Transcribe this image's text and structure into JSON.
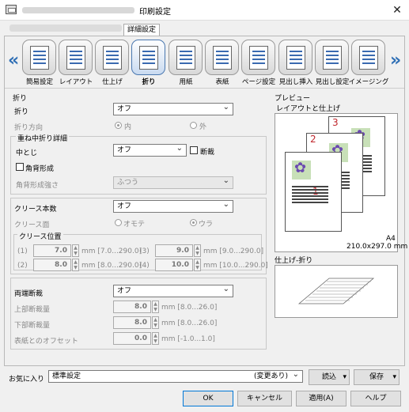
{
  "window": {
    "title": "印刷設定",
    "close_icon": "close-icon"
  },
  "tabs": {
    "active": "詳細設定"
  },
  "functions": [
    {
      "label": "簡易設定",
      "icon": "quick-settings-icon"
    },
    {
      "label": "レイアウト",
      "icon": "layout-icon"
    },
    {
      "label": "仕上げ",
      "icon": "finishing-icon"
    },
    {
      "label": "折り",
      "icon": "fold-icon",
      "selected": true
    },
    {
      "label": "用紙",
      "icon": "paper-icon"
    },
    {
      "label": "表紙",
      "icon": "cover-icon"
    },
    {
      "label": "ページ設定",
      "icon": "page-setup-icon"
    },
    {
      "label": "見出し挿入",
      "icon": "tab-insert-icon"
    },
    {
      "label": "見出し設定",
      "icon": "tab-settings-icon"
    },
    {
      "label": "イメージング",
      "icon": "imaging-icon"
    }
  ],
  "fold": {
    "section": "折り",
    "fold_label": "折り",
    "fold_value": "オフ",
    "direction_label": "折り方向",
    "dir_in": "内",
    "dir_out": "外",
    "saddle_section": "重ね中折り詳細",
    "staple_label": "中とじ",
    "staple_value": "オフ",
    "trim_label": "断裁",
    "square_label": "角背形成",
    "square_strength_label": "角背形成強さ",
    "square_strength_value": "ふつう",
    "crease_label": "クリース本数",
    "crease_value": "オフ",
    "crease_side_label": "クリース面",
    "crease_front": "オモテ",
    "crease_back": "ウラ",
    "crease_pos_label": "クリース位置",
    "pos": [
      {
        "n": "(1)",
        "v": "7.0",
        "r": "mm [7.0...290.0]"
      },
      {
        "n": "(3)",
        "v": "9.0",
        "r": "mm [9.0...290.0]"
      },
      {
        "n": "(2)",
        "v": "8.0",
        "r": "mm [8.0...290.0]"
      },
      {
        "n": "(4)",
        "v": "10.0",
        "r": "mm [10.0...290.0]"
      }
    ],
    "trim2_label": "両端断裁",
    "trim2_value": "オフ",
    "top_label": "上部断裁量",
    "top_value": "8.0",
    "top_range": "mm [8.0...26.0]",
    "bottom_label": "下部断裁量",
    "bottom_value": "8.0",
    "bottom_range": "mm [8.0...26.0]",
    "offset_label": "表紙とのオフセット",
    "offset_value": "0.0",
    "offset_range": "mm [-1.0...1.0]"
  },
  "preview": {
    "section": "プレビュー",
    "layout_label": "レイアウトと仕上げ",
    "paper": "A4",
    "size": "210.0x297.0 mm",
    "pages": [
      "1",
      "2",
      "3"
    ],
    "finish_label": "仕上げ-折り"
  },
  "favorites": {
    "label": "お気に入り",
    "value": "標準設定",
    "changed": "(変更あり)",
    "load": "読込",
    "save": "保存"
  },
  "buttons": {
    "ok": "OK",
    "cancel": "キャンセル",
    "apply": "適用(A)",
    "help": "ヘルプ"
  }
}
